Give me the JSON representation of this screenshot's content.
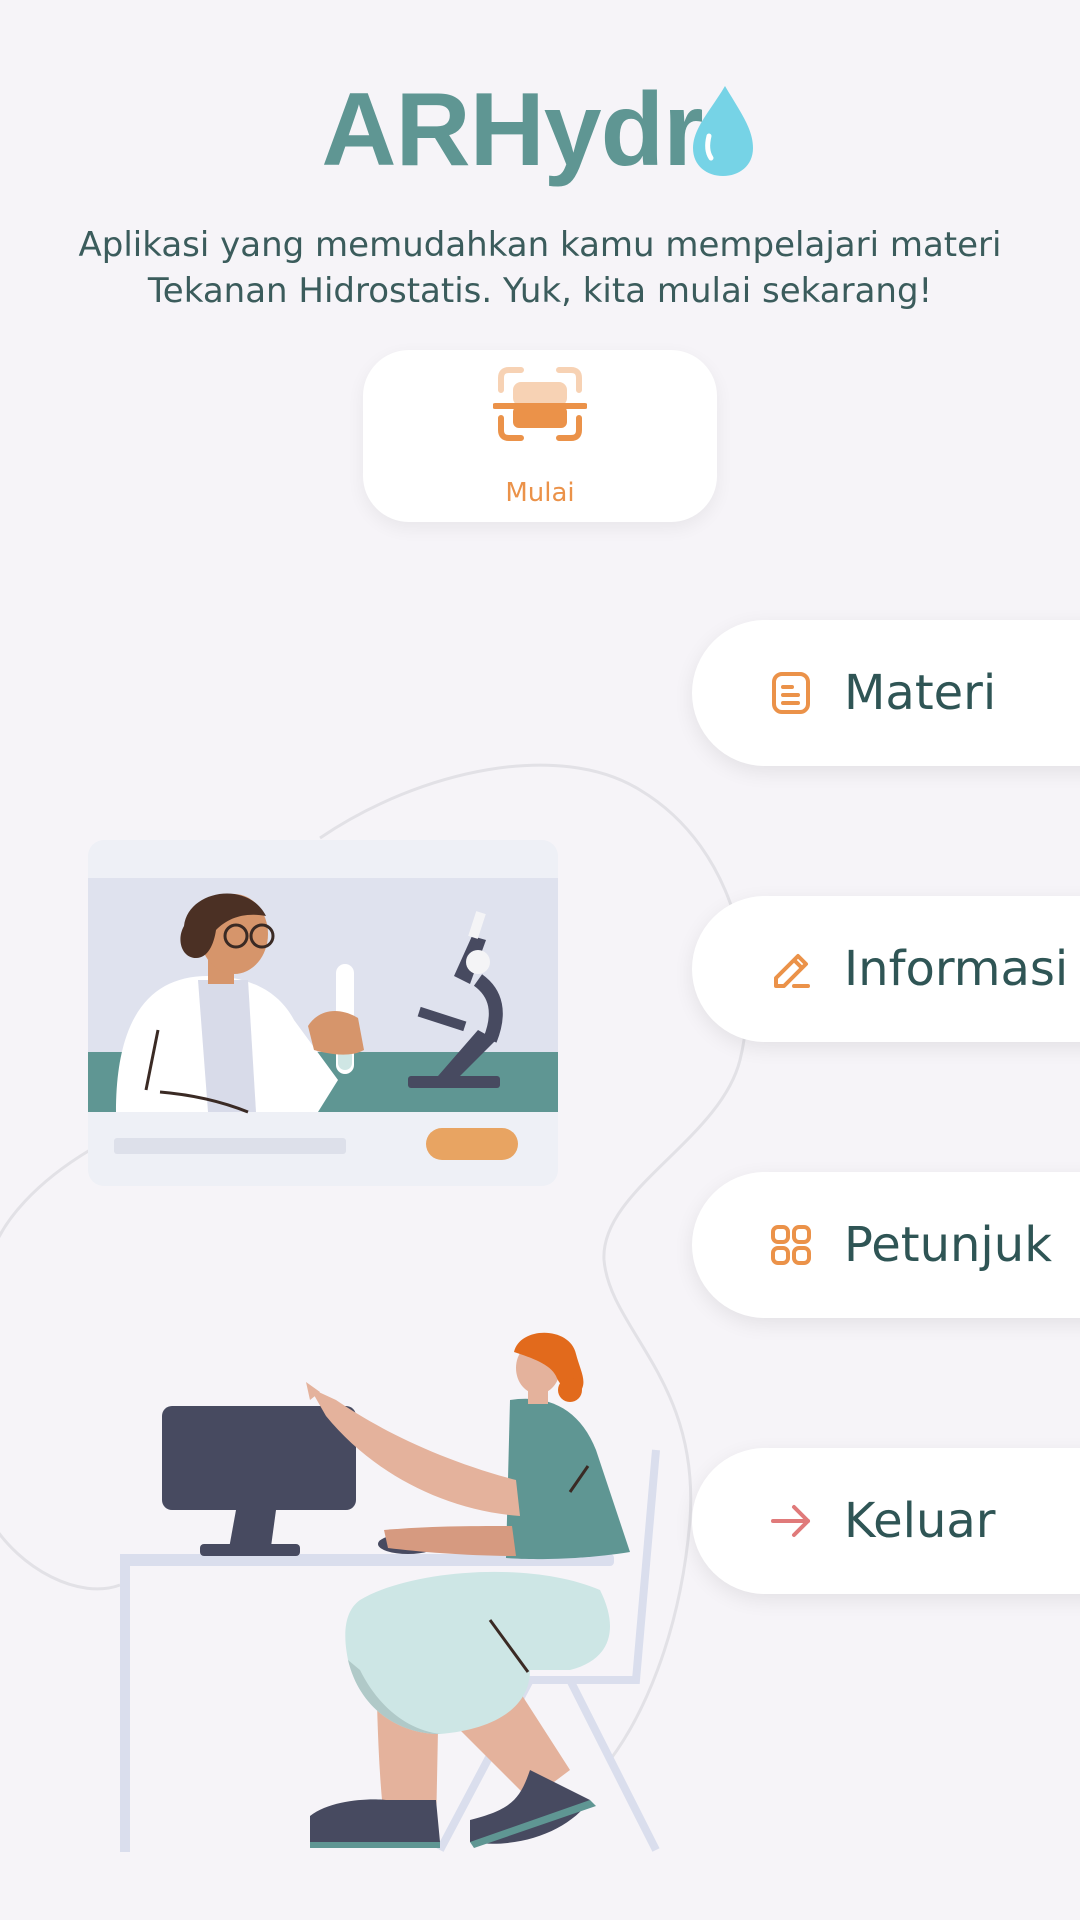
{
  "app": {
    "logo_text": "ARHydr",
    "tagline_line1": "Aplikasi yang memudahkan kamu mempelajari materi",
    "tagline_line2": "Tekanan Hidrostatis. Yuk, kita mulai sekarang!"
  },
  "start": {
    "label": "Mulai",
    "icon": "ar-scan-icon"
  },
  "menu": [
    {
      "label": "Materi",
      "icon": "document-icon"
    },
    {
      "label": "Informasi",
      "icon": "pencil-icon"
    },
    {
      "label": "Petunjuk",
      "icon": "grid-icon"
    },
    {
      "label": "Keluar",
      "icon": "arrow-right-icon"
    }
  ],
  "colors": {
    "background": "#f6f4f8",
    "brand_teal": "#5f9693",
    "accent_orange": "#eb9249",
    "drop_blue": "#76d3e6",
    "exit_red": "#e07a7a"
  }
}
